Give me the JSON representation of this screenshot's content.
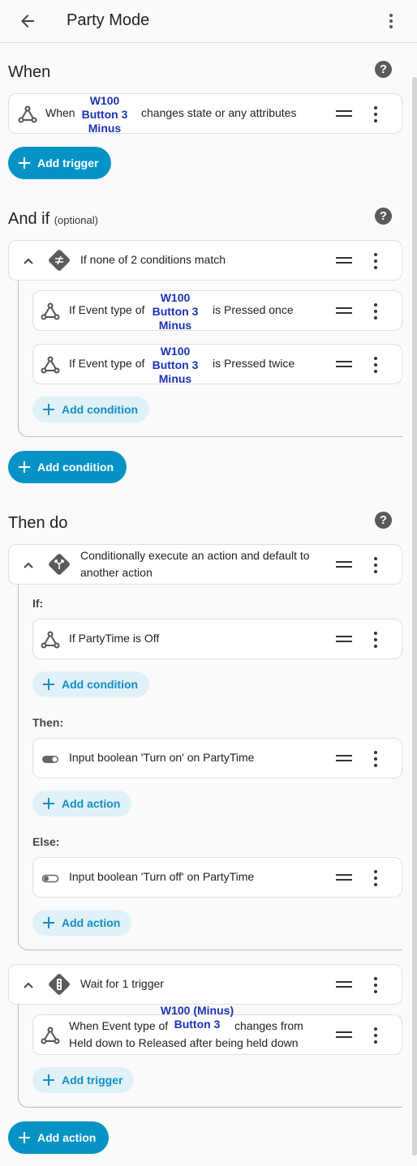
{
  "header": {
    "title": "Party Mode"
  },
  "sections": {
    "when": {
      "title": "When"
    },
    "and_if": {
      "title": "And if",
      "optional": "(optional)"
    },
    "then_do": {
      "title": "Then do"
    }
  },
  "trigger": {
    "prefix": "When",
    "entity": [
      "W100",
      "Button 3",
      "Minus"
    ],
    "suffix": "changes state or any attributes"
  },
  "buttons": {
    "add_trigger": "Add trigger",
    "add_condition": "Add condition",
    "add_action": "Add action"
  },
  "condition_group": {
    "label": "If none of 2 conditions match",
    "items": [
      {
        "prefix": "If Event type of",
        "entity": [
          "W100",
          "Button 3",
          "Minus"
        ],
        "suffix": "is Pressed once"
      },
      {
        "prefix": "If Event type of",
        "entity": [
          "W100",
          "Button 3",
          "Minus"
        ],
        "suffix": "is Pressed twice"
      }
    ]
  },
  "choose": {
    "label_line1": "Conditionally execute an action and default to",
    "label_line2": "another action",
    "if_label": "If:",
    "if_item": "If PartyTime is Off",
    "then_label": "Then:",
    "then_item": "Input boolean 'Turn on' on PartyTime",
    "else_label": "Else:",
    "else_item": "Input boolean 'Turn off' on PartyTime"
  },
  "wait": {
    "label": "Wait for 1 trigger",
    "entity_line1": "W100 (Minus)",
    "entity_line2": "Button 3",
    "line1_prefix": "When Event type of",
    "line1_suffix": "changes from",
    "line2": "Held down to Released after being held down"
  },
  "icons": {
    "back": "arrow-left-icon",
    "menu": "dots-vertical-icon",
    "help": "help-circle-icon",
    "trigger": "state-trigger-icon",
    "not": "not-equal-icon",
    "choose": "source-branch-icon",
    "wait": "traffic-light-icon",
    "toggle": "toggle-switch-icon",
    "drag": "drag-handle-icon",
    "collapse": "chevron-up-icon"
  },
  "colors": {
    "accent": "#0493c4",
    "accent_light": "#e1f1f8",
    "entity": "#1a33b5"
  }
}
